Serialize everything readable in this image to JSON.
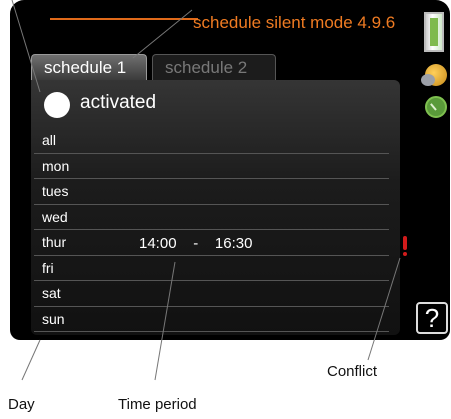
{
  "header": {
    "title": "schedule silent mode 4.9.6"
  },
  "tabs": [
    {
      "label": "schedule 1",
      "active": true
    },
    {
      "label": "schedule 2",
      "active": false
    }
  ],
  "activation": {
    "label": "activated",
    "checked": false
  },
  "schedule_rows": [
    {
      "day": "all"
    },
    {
      "day": "mon"
    },
    {
      "day": "tues"
    },
    {
      "day": "wed"
    },
    {
      "day": "thur",
      "start": "14:00",
      "separator": "-",
      "end": "16:30",
      "conflict": true
    },
    {
      "day": "fri"
    },
    {
      "day": "sat"
    },
    {
      "day": "sun"
    }
  ],
  "side_icons": [
    "battery-status-icon",
    "weather-icon",
    "clock-icon",
    "help-icon"
  ],
  "help_label": "?",
  "callouts": {
    "day": "Day",
    "time_period": "Time period",
    "conflict": "Conflict"
  },
  "colors": {
    "accent": "#ef7b22",
    "conflict": "#d21b1b",
    "screen": "#000000"
  }
}
